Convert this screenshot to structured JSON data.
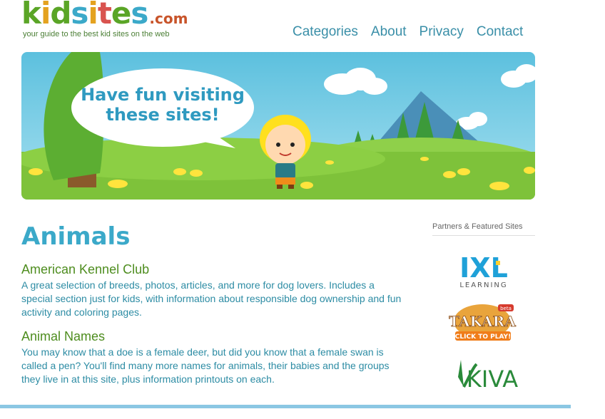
{
  "logo": {
    "letters": [
      {
        "ch": "k",
        "color": "#5aa526"
      },
      {
        "ch": "i",
        "color": "#e4a21f"
      },
      {
        "ch": "d",
        "color": "#5aa526"
      },
      {
        "ch": "s",
        "color": "#3ba9c9"
      },
      {
        "ch": "i",
        "color": "#e4a21f"
      },
      {
        "ch": "t",
        "color": "#d9534f"
      },
      {
        "ch": "e",
        "color": "#5aa526"
      },
      {
        "ch": "s",
        "color": "#3ba9c9"
      }
    ],
    "dotcom": ".com",
    "tagline": "your guide to the best kid sites on the web"
  },
  "nav": {
    "categories": "Categories",
    "about": "About",
    "privacy": "Privacy",
    "contact": "Contact"
  },
  "banner": {
    "speech_line1": "Have fun visiting",
    "speech_line2": "these sites!"
  },
  "main": {
    "title": "Animals",
    "sites": [
      {
        "title": "American Kennel Club",
        "description": "A great selection of breeds, photos, articles, and more for dog lovers. Includes a special section just for kids, with information about responsible dog ownership and fun activity and coloring pages."
      },
      {
        "title": "Animal Names",
        "description": "You may know that a doe is a female deer, but did you know that a female swan is called a pen? You'll find many more names for animals, their babies and the groups they live in at this site, plus information printouts on each."
      }
    ]
  },
  "sidebar": {
    "title": "Partners & Featured Sites",
    "ixl": {
      "main": "IXL",
      "sub": "LEARNING"
    },
    "takara": {
      "beta": "beta",
      "main": "TAKARA",
      "sub": "CLICK TO PLAY!"
    },
    "kiva": {
      "main": "KIVA"
    }
  },
  "colors": {
    "nav": "#3a8fa8",
    "title": "#3ba9c9",
    "site_title": "#4e8d1f",
    "site_desc": "#2d8ca4",
    "bottom_bar": "#8bc7e3"
  }
}
